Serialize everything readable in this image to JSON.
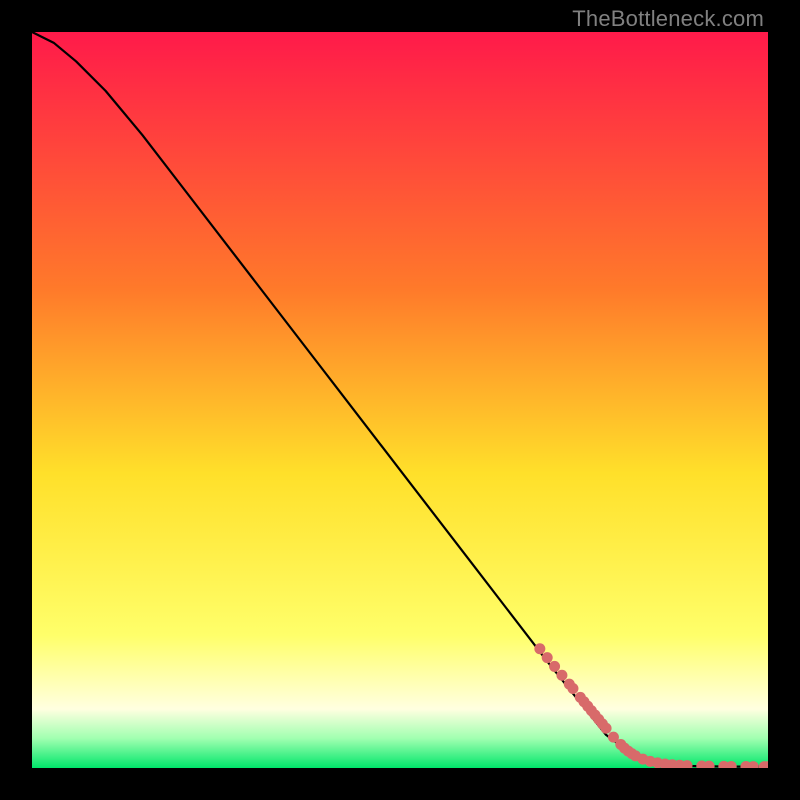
{
  "watermark": "TheBottleneck.com",
  "colors": {
    "gradient_top": "#ff1a4a",
    "gradient_mid_upper": "#ff7a2a",
    "gradient_mid": "#ffe02a",
    "gradient_mid_lower": "#ffff6a",
    "gradient_pale": "#ffffe0",
    "gradient_green_light": "#a0ffb0",
    "gradient_green": "#00e66a",
    "curve": "#000000",
    "marker": "#d86a6a"
  },
  "chart_data": {
    "type": "line",
    "title": "",
    "xlabel": "",
    "ylabel": "",
    "xlim": [
      0,
      100
    ],
    "ylim": [
      0,
      100
    ],
    "series": [
      {
        "name": "curve",
        "x": [
          0,
          3,
          6,
          10,
          15,
          20,
          30,
          40,
          50,
          60,
          70,
          78,
          82,
          85,
          88,
          90,
          92,
          94,
          96,
          98,
          100
        ],
        "y": [
          100,
          98.5,
          96,
          92,
          86,
          79.5,
          66.5,
          53.5,
          40.5,
          27.5,
          14.5,
          4.5,
          1.5,
          0.6,
          0.3,
          0.25,
          0.22,
          0.2,
          0.19,
          0.18,
          0.18
        ]
      }
    ],
    "markers": {
      "name": "highlight-points",
      "x": [
        69,
        70,
        71,
        72,
        73,
        73.5,
        74.5,
        75,
        75.5,
        76,
        76.5,
        77,
        77.5,
        78,
        79,
        80,
        80.5,
        81,
        81.5,
        82,
        83,
        84,
        85,
        86,
        87,
        88,
        89,
        91,
        92,
        94,
        95,
        97,
        98,
        99.5,
        100
      ],
      "y": [
        16.2,
        15.0,
        13.8,
        12.6,
        11.4,
        10.8,
        9.6,
        9.0,
        8.4,
        7.8,
        7.2,
        6.6,
        6.0,
        5.4,
        4.2,
        3.2,
        2.7,
        2.3,
        1.95,
        1.65,
        1.2,
        0.9,
        0.7,
        0.55,
        0.45,
        0.38,
        0.32,
        0.27,
        0.25,
        0.22,
        0.21,
        0.2,
        0.19,
        0.18,
        0.18
      ]
    }
  }
}
